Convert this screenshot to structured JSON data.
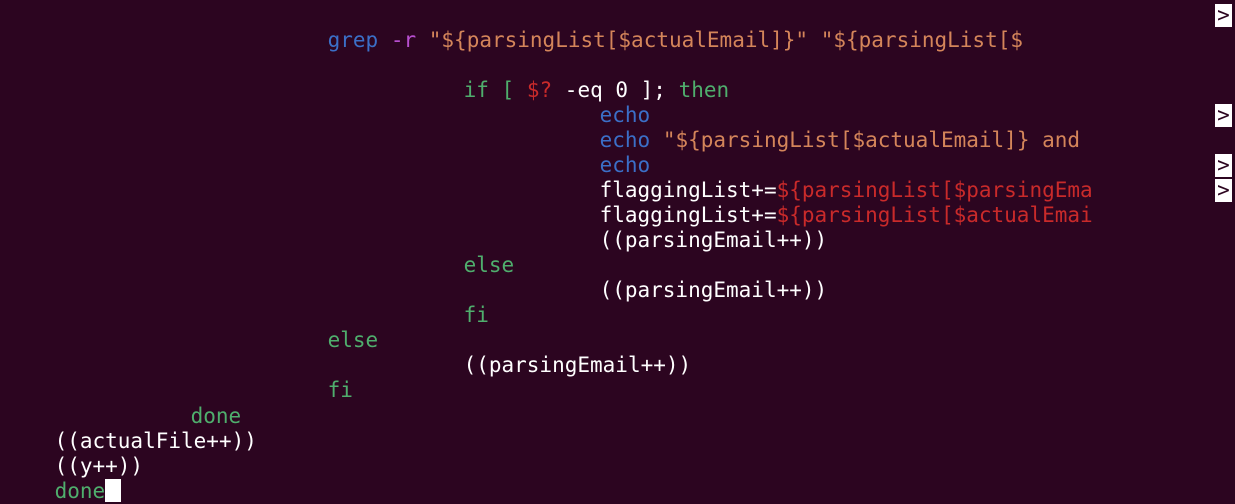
{
  "lines": {
    "l1": {
      "grep": "grep",
      "flag": "-r",
      "str1": "\"${parsingList[$actualEmail]}\"",
      "str2": "\"${parsingList[$",
      "more": ">"
    },
    "l2": {
      "if": "if",
      "open": "[",
      "status": "$?",
      "rest": "-eq 0 ];",
      "then": "then"
    },
    "l3": {
      "echo": "echo"
    },
    "l4": {
      "echo": "echo",
      "str": "\"${parsingList[$actualEmail]} and",
      "more": ">"
    },
    "l5": {
      "echo": "echo"
    },
    "l6": {
      "prefix": "flaggingList+=",
      "val": "${parsingList[$parsingEma",
      "more": ">"
    },
    "l7": {
      "prefix": "flaggingList+=",
      "val": "${parsingList[$actualEmai",
      "more": ">"
    },
    "l8": {
      "text": "((parsingEmail++))"
    },
    "l9": {
      "else": "else"
    },
    "l10": {
      "text": "((parsingEmail++))"
    },
    "l11": {
      "fi": "fi"
    },
    "l12": {
      "else": "else"
    },
    "l13": {
      "text": "((parsingEmail++))"
    },
    "l14": {
      "fi": "fi"
    },
    "l15": {
      "done": "done"
    },
    "l16": {
      "text": "((actualFile++))"
    },
    "l17": {
      "text": "((y++))"
    },
    "l18": {
      "done": "done"
    }
  },
  "colors": {
    "background": "#2c0520",
    "keyword_green": "#4fae6d",
    "keyword_blue": "#3b6fc7",
    "string_orange": "#d4855a",
    "variable_red": "#c92a2a"
  }
}
